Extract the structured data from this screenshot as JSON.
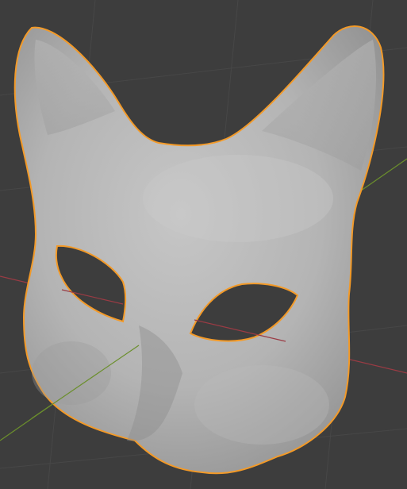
{
  "viewport": {
    "background": "#3d3d3d",
    "grid_color": "#4a4a4a",
    "axis_x_color": "#9b3b44",
    "axis_y_color": "#6b8f2c",
    "selection_outline_color": "#f39a28",
    "object": "cat-mask-mesh"
  }
}
